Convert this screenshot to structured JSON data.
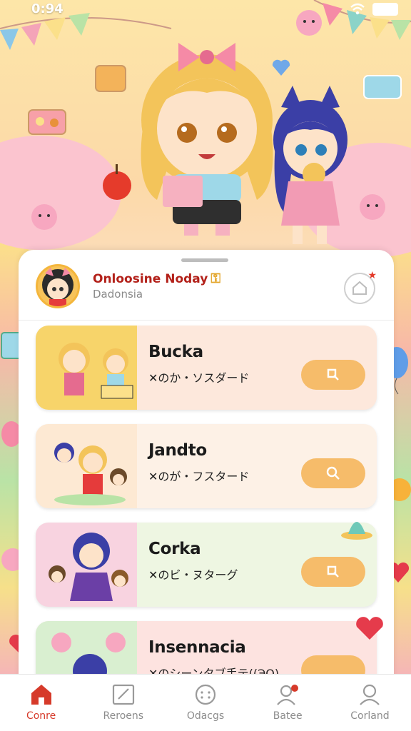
{
  "status_bar": {
    "time": "0:94"
  },
  "profile": {
    "title": "Onloosine Noday",
    "subtitle": "Dadonsia"
  },
  "list": [
    {
      "title": "Bucka",
      "subtitle": "✕のか・ソスダード",
      "bg": "#fde8dc",
      "thumb_bg": "#f7d46a"
    },
    {
      "title": "Jandto",
      "subtitle": "✕のが・フスタード",
      "bg": "#fdf1e6",
      "thumb_bg": "#fde9d3"
    },
    {
      "title": "Corka",
      "subtitle": "✕のビ・ヌターグ",
      "bg": "#eef6e2",
      "thumb_bg": "#f8d3e0"
    },
    {
      "title": "Insennacia",
      "subtitle": "✕のシーンタブ手テ((ЭO)",
      "bg": "#fde3e0",
      "thumb_bg": "#d9efd0"
    }
  ],
  "nav": [
    {
      "label": "Conre",
      "icon": "home-icon",
      "active": true
    },
    {
      "label": "Reroens",
      "icon": "edit-icon",
      "active": false
    },
    {
      "label": "Odacgs",
      "icon": "chat-icon",
      "active": false
    },
    {
      "label": "Batee",
      "icon": "profile-badge-icon",
      "active": false
    },
    {
      "label": "Corland",
      "icon": "user-icon",
      "active": false
    }
  ],
  "colors": {
    "accent": "#d63a2a",
    "button": "#f6bc6a"
  }
}
